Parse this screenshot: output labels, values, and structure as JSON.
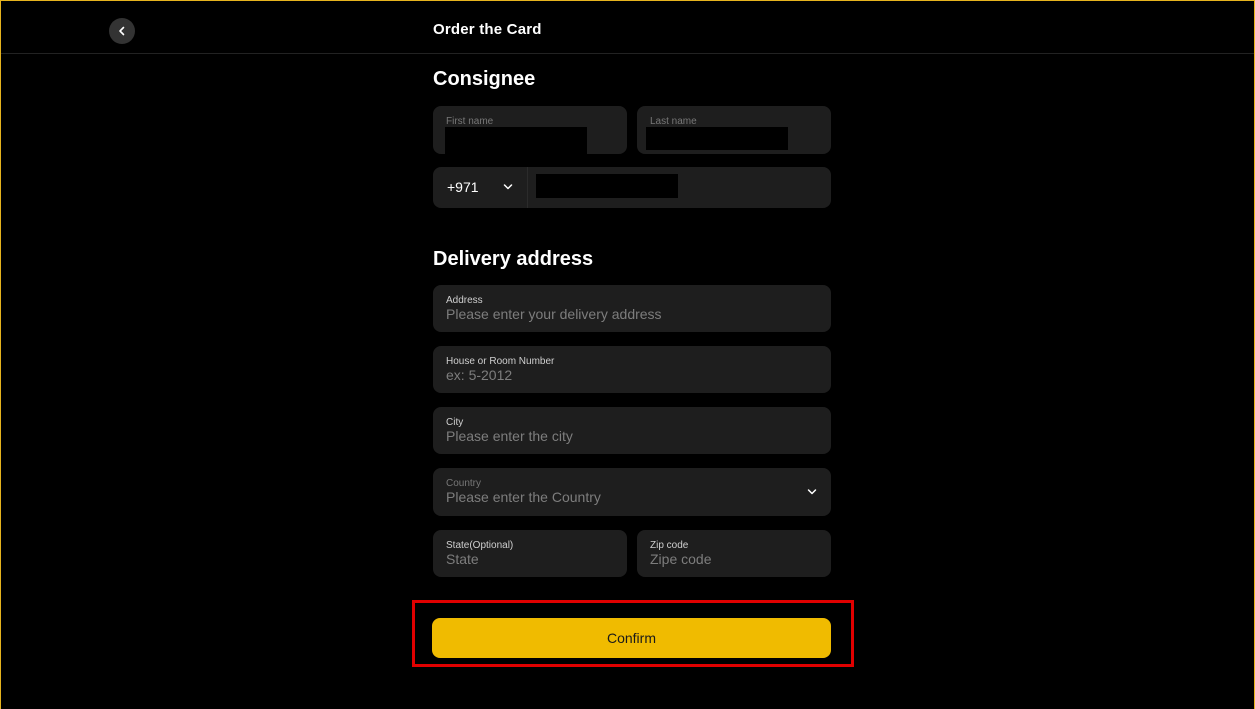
{
  "header": {
    "title": "Order the Card"
  },
  "consignee": {
    "title": "Consignee",
    "first_name_label": "First name",
    "last_name_label": "Last name",
    "phone_code": "+971"
  },
  "delivery": {
    "title": "Delivery address",
    "address": {
      "label": "Address",
      "placeholder": "Please enter your delivery address"
    },
    "house": {
      "label": "House or Room Number",
      "placeholder": "ex: 5-2012"
    },
    "city": {
      "label": "City",
      "placeholder": "Please enter the city"
    },
    "country": {
      "label": "Country",
      "placeholder": "Please enter the Country"
    },
    "state": {
      "label": "State(Optional)",
      "placeholder": "State"
    },
    "zip": {
      "label": "Zip code",
      "placeholder": "Zipe code"
    }
  },
  "confirm_label": "Confirm",
  "colors": {
    "accent": "#f0bb00",
    "field_bg": "#1e1e1e",
    "frame": "#e6b31e",
    "highlight": "#e00000"
  }
}
